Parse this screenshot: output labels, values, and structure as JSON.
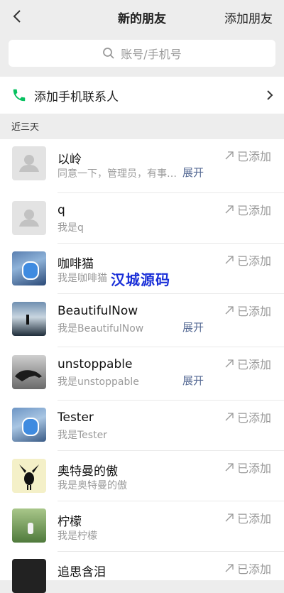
{
  "header": {
    "title": "新的朋友",
    "add_label": "添加朋友"
  },
  "search": {
    "placeholder": "账号/手机号"
  },
  "phone_row": {
    "label": "添加手机联系人"
  },
  "section": {
    "title": "近三天"
  },
  "status_label": "已添加",
  "watermark": "汉城源码",
  "friends": [
    {
      "name": "以岭",
      "msg": "同意一下，管理员，有事…",
      "expand": "展开",
      "avatar": "placeholder"
    },
    {
      "name": "q",
      "msg": "我是q",
      "expand": "",
      "avatar": "placeholder"
    },
    {
      "name": "咖啡猫",
      "msg": "我是咖啡猫",
      "expand": "",
      "avatar": "robot-city"
    },
    {
      "name": "BeautifulNow",
      "msg": "我是BeautifulNow",
      "expand": "展开",
      "avatar": "lake-silhouette"
    },
    {
      "name": "unstoppable",
      "msg": "我是unstoppable",
      "expand": "展开",
      "avatar": "panther"
    },
    {
      "name": "Tester",
      "msg": "我是Tester",
      "expand": "",
      "avatar": "robot-city"
    },
    {
      "name": "奥特曼的傲",
      "msg": "我是奥特曼的傲",
      "expand": "",
      "avatar": "bunny-silhouette"
    },
    {
      "name": "柠檬",
      "msg": "我是柠檬",
      "expand": "",
      "avatar": "girl-field"
    },
    {
      "name": "追思含泪",
      "msg": "",
      "expand": "",
      "avatar": "dark"
    }
  ],
  "colors": {
    "link": "#576b95",
    "phone_green": "#07c160",
    "watermark": "#1a2fd8"
  }
}
